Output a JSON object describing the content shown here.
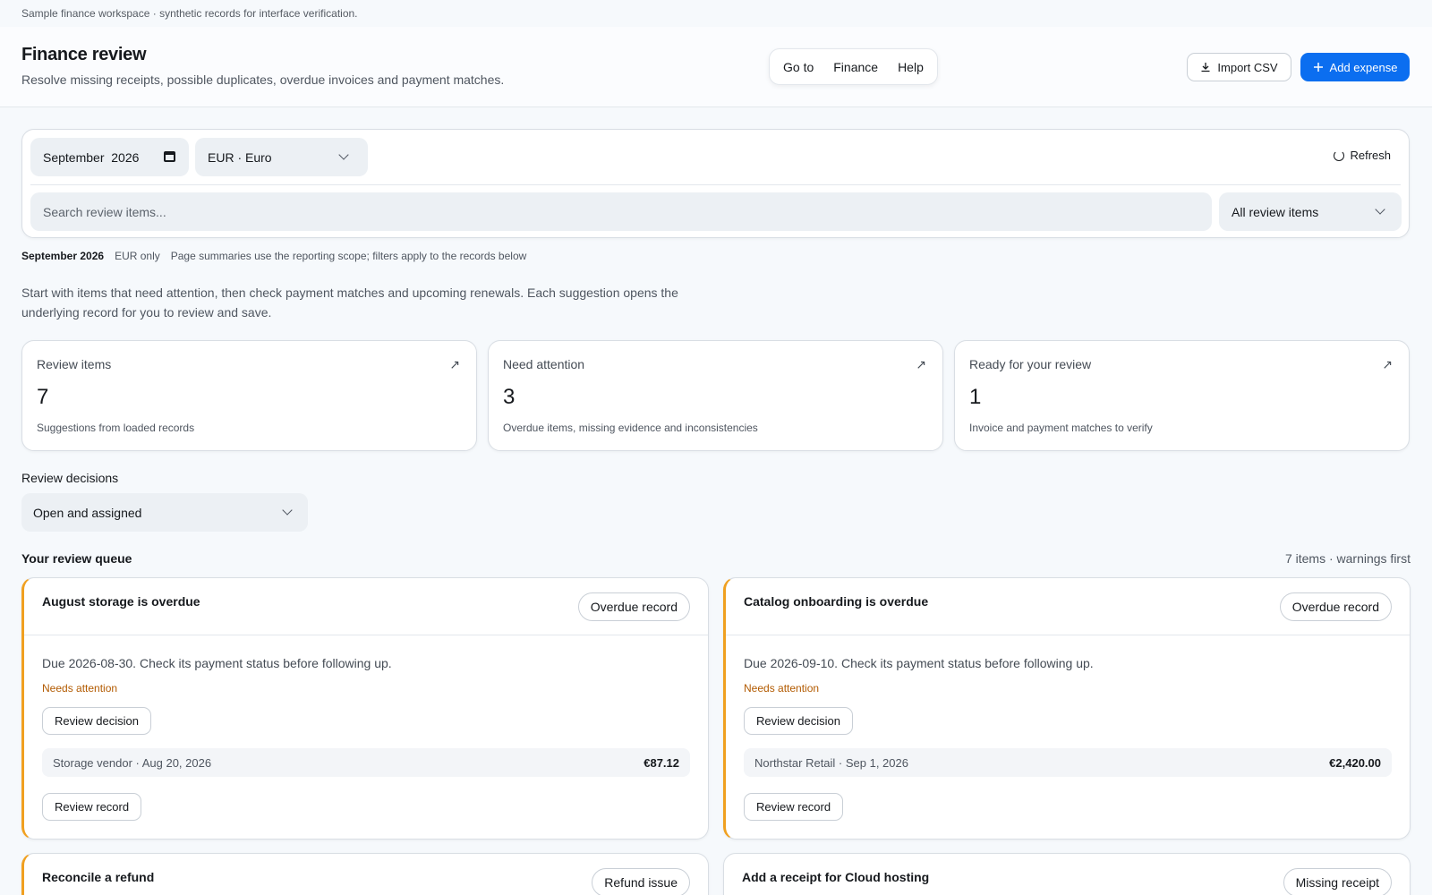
{
  "notice": "Sample finance workspace · synthetic records for interface verification.",
  "header": {
    "title": "Finance review",
    "subtitle": "Resolve missing receipts, possible duplicates, overdue invoices and payment matches.",
    "nav": [
      "Go to",
      "Finance",
      "Help"
    ],
    "import_label": "Import CSV",
    "add_label": "Add expense"
  },
  "filters": {
    "month": "September  2026",
    "currency": "EUR · Euro",
    "refresh_label": "Refresh",
    "search_placeholder": "Search review items...",
    "type": "All review items"
  },
  "scope": {
    "period": "September 2026",
    "currency": "EUR only",
    "note": "Page summaries use the reporting scope; filters apply to the records below"
  },
  "intro": "Start with items that need attention, then check payment matches and upcoming renewals. Each suggestion opens the underlying record for you to review and save.",
  "stats": [
    {
      "label": "Review items",
      "value": "7",
      "desc": "Suggestions from loaded records"
    },
    {
      "label": "Need attention",
      "value": "3",
      "desc": "Overdue items, missing evidence and inconsistencies"
    },
    {
      "label": "Ready for your review",
      "value": "1",
      "desc": "Invoice and payment matches to verify"
    }
  ],
  "decisions": {
    "label": "Review decisions",
    "value": "Open and assigned"
  },
  "queue": {
    "title": "Your review queue",
    "count": "7 items · warnings first",
    "cards": [
      {
        "title": "August storage is overdue",
        "tag": "Overdue record",
        "message": "Due 2026-08-30. Check its payment status before following up.",
        "attention": "Needs attention",
        "decision_label": "Review decision",
        "meta": "Storage vendor · Aug 20, 2026",
        "amount": "€87.12",
        "record_label": "Review record"
      },
      {
        "title": "Catalog onboarding is overdue",
        "tag": "Overdue record",
        "message": "Due 2026-09-10. Check its payment status before following up.",
        "attention": "Needs attention",
        "decision_label": "Review decision",
        "meta": "Northstar Retail · Sep 1, 2026",
        "amount": "€2,420.00",
        "record_label": "Review record"
      },
      {
        "title": "Reconcile a refund",
        "tag": "Refund issue"
      },
      {
        "title": "Add a receipt for Cloud hosting",
        "tag": "Missing receipt"
      }
    ]
  },
  "colors": {
    "accent": "#0b6ef0",
    "warning_border": "#f0a020",
    "attention_text": "#b25a00"
  }
}
